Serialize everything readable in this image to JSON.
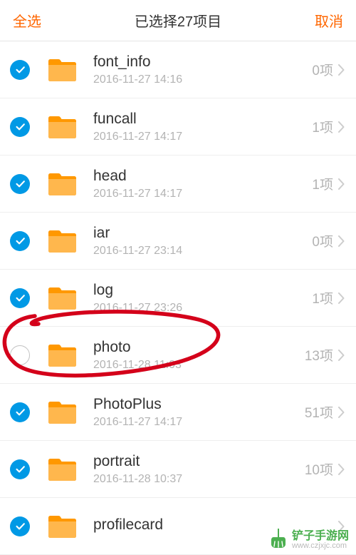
{
  "header": {
    "select_all": "全选",
    "title": "已选择27项目",
    "cancel": "取消"
  },
  "count_suffix": "项",
  "items": [
    {
      "name": "font_info",
      "date": "2016-11-27 14:16",
      "count": 0,
      "selected": true
    },
    {
      "name": "funcall",
      "date": "2016-11-27 14:17",
      "count": 1,
      "selected": true
    },
    {
      "name": "head",
      "date": "2016-11-27 14:17",
      "count": 1,
      "selected": true
    },
    {
      "name": "iar",
      "date": "2016-11-27 23:14",
      "count": 0,
      "selected": true
    },
    {
      "name": "log",
      "date": "2016-11-27 23:26",
      "count": 1,
      "selected": true
    },
    {
      "name": "photo",
      "date": "2016-11-28 11:03",
      "count": 13,
      "selected": false
    },
    {
      "name": "PhotoPlus",
      "date": "2016-11-27 14:17",
      "count": 51,
      "selected": true
    },
    {
      "name": "portrait",
      "date": "2016-11-28 10:37",
      "count": 10,
      "selected": true
    },
    {
      "name": "profilecard",
      "date": "",
      "count": "",
      "selected": true
    }
  ],
  "branding": {
    "text": "铲子手游网",
    "sub": "www.czjxjc.com"
  },
  "colors": {
    "accent": "#ff6600",
    "check": "#0099e5",
    "folder_light": "#ffb74d",
    "folder_dark": "#ff9800"
  }
}
